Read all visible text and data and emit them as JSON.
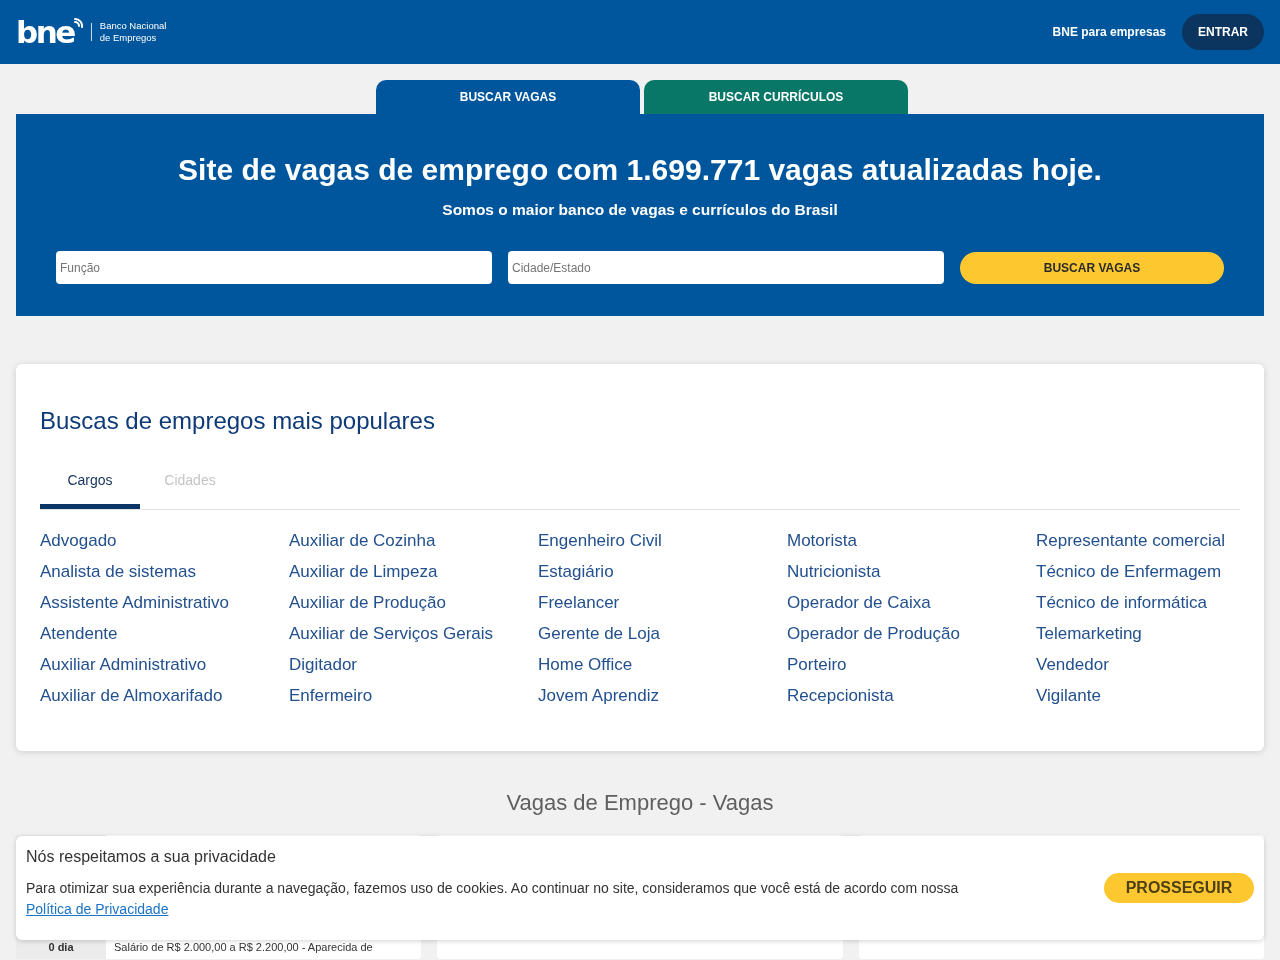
{
  "header": {
    "logo": {
      "wordmark": "bne",
      "tagline": [
        "Banco Nacional",
        "de Empregos"
      ]
    },
    "links": [
      {
        "label": "BNE para empresas",
        "kind": "link"
      },
      {
        "label": "ENTRAR",
        "kind": "button"
      }
    ]
  },
  "search_tabs": [
    {
      "label": "BUSCAR VAGAS",
      "selected": true
    },
    {
      "label": "BUSCAR CURRÍCULOS",
      "selected": false
    }
  ],
  "hero": {
    "title": "Site de vagas de emprego com 1.699.771 vagas atualizadas hoje.",
    "subtitle": "Somos o maior banco de vagas e currículos do Brasil",
    "fields": [
      {
        "placeholder": "Função"
      },
      {
        "placeholder": "Cidade/Estado"
      }
    ],
    "button": "BUSCAR VAGAS"
  },
  "popular_searches": {
    "title": "Buscas de empregos mais populares",
    "tabs": [
      {
        "label": "Cargos",
        "selected": true
      },
      {
        "label": "Cidades",
        "selected": false
      }
    ],
    "columns": [
      [
        "Advogado",
        "Analista de sistemas",
        "Assistente Administrativo",
        "Atendente",
        "Auxiliar Administrativo",
        "Auxiliar de Almoxarifado"
      ],
      [
        "Auxiliar de Cozinha",
        "Auxiliar de Limpeza",
        "Auxiliar de Produção",
        "Auxiliar de Serviços Gerais",
        "Digitador",
        "Enfermeiro"
      ],
      [
        "Engenheiro Civil",
        "Estagiário",
        "Freelancer",
        "Gerente de Loja",
        "Home Office",
        "Jovem Aprendiz"
      ],
      [
        "Motorista",
        "Nutricionista",
        "Operador de Caixa",
        "Operador de Produção",
        "Porteiro",
        "Recepcionista"
      ],
      [
        "Representante comercial",
        "Técnico de Enfermagem",
        "Técnico de informática",
        "Telemarketing",
        "Vendedor",
        "Vigilante"
      ]
    ]
  },
  "jobs_section": {
    "title": "Vagas de Emprego - Vagas",
    "jobs": [
      {
        "age": "0 dia",
        "summary": "Salário de R$ 2.000,00 a R$ 2.200,00 - Aparecida de"
      }
    ]
  },
  "cookie_banner": {
    "title": "Nós respeitamos a sua privacidade",
    "text": "Para otimizar sua experiência durante a navegação, fazemos uso de cookies. Ao continuar no site, consideramos que você está de acordo com nossa",
    "link": "Política de Privacidade",
    "button": "PROSSEGUIR"
  }
}
